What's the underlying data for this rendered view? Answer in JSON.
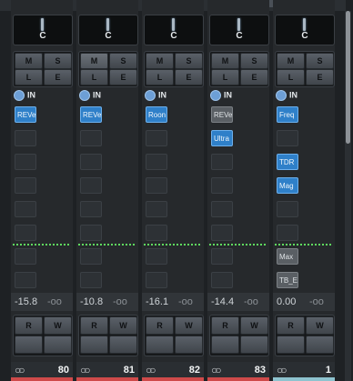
{
  "top_controls": {
    "btn1": "",
    "btn2": "▶",
    "plus": "+"
  },
  "channels": [
    {
      "pan_label": "C",
      "input_label": "IN",
      "buttons": {
        "m": "M",
        "s": "S",
        "l": "L",
        "e": "E",
        "r": "R",
        "w": "W"
      },
      "inserts": [
        "REVe",
        "",
        "",
        "",
        "",
        ""
      ],
      "level": "-15.8",
      "peak": "-oo",
      "number": "80",
      "link_icon": "link-icon"
    },
    {
      "pan_label": "C",
      "input_label": "IN",
      "buttons": {
        "m": "M",
        "s": "S",
        "l": "L",
        "e": "E",
        "r": "R",
        "w": "W"
      },
      "inserts": [
        "REVe",
        "",
        "",
        "",
        "",
        ""
      ],
      "level": "-10.8",
      "peak": "-oo",
      "number": "81",
      "link_icon": "link-icon"
    },
    {
      "pan_label": "C",
      "input_label": "IN",
      "buttons": {
        "m": "M",
        "s": "S",
        "l": "L",
        "e": "E",
        "r": "R",
        "w": "W"
      },
      "inserts": [
        "Roon",
        "",
        "",
        "",
        "",
        ""
      ],
      "level": "-16.1",
      "peak": "-oo",
      "number": "82",
      "link_icon": "link-icon"
    },
    {
      "pan_label": "C",
      "input_label": "IN",
      "buttons": {
        "m": "M",
        "s": "S",
        "l": "L",
        "e": "E",
        "r": "R",
        "w": "W"
      },
      "inserts": [
        "REVe",
        "Ultra",
        "",
        "",
        "",
        ""
      ],
      "level": "-14.4",
      "peak": "-oo",
      "number": "83",
      "link_icon": "link-icon"
    },
    {
      "pan_label": "C",
      "input_label": "IN",
      "buttons": {
        "m": "M",
        "s": "S",
        "l": "L",
        "e": "E",
        "r": "R",
        "w": "W"
      },
      "inserts": [
        "Freq",
        "",
        "TDR",
        "Mag",
        "",
        "",
        "Max",
        "TB_E"
      ],
      "level": "0.00",
      "peak": "-oo",
      "number": "1",
      "link_icon": "link-icon"
    }
  ],
  "colors": {
    "insert_active": "#2f80c9",
    "insert_bypassed": "#5a5f64",
    "channel_bar_red": "#cf4a4a",
    "channel_bar_blue": "#8ec3cf"
  }
}
